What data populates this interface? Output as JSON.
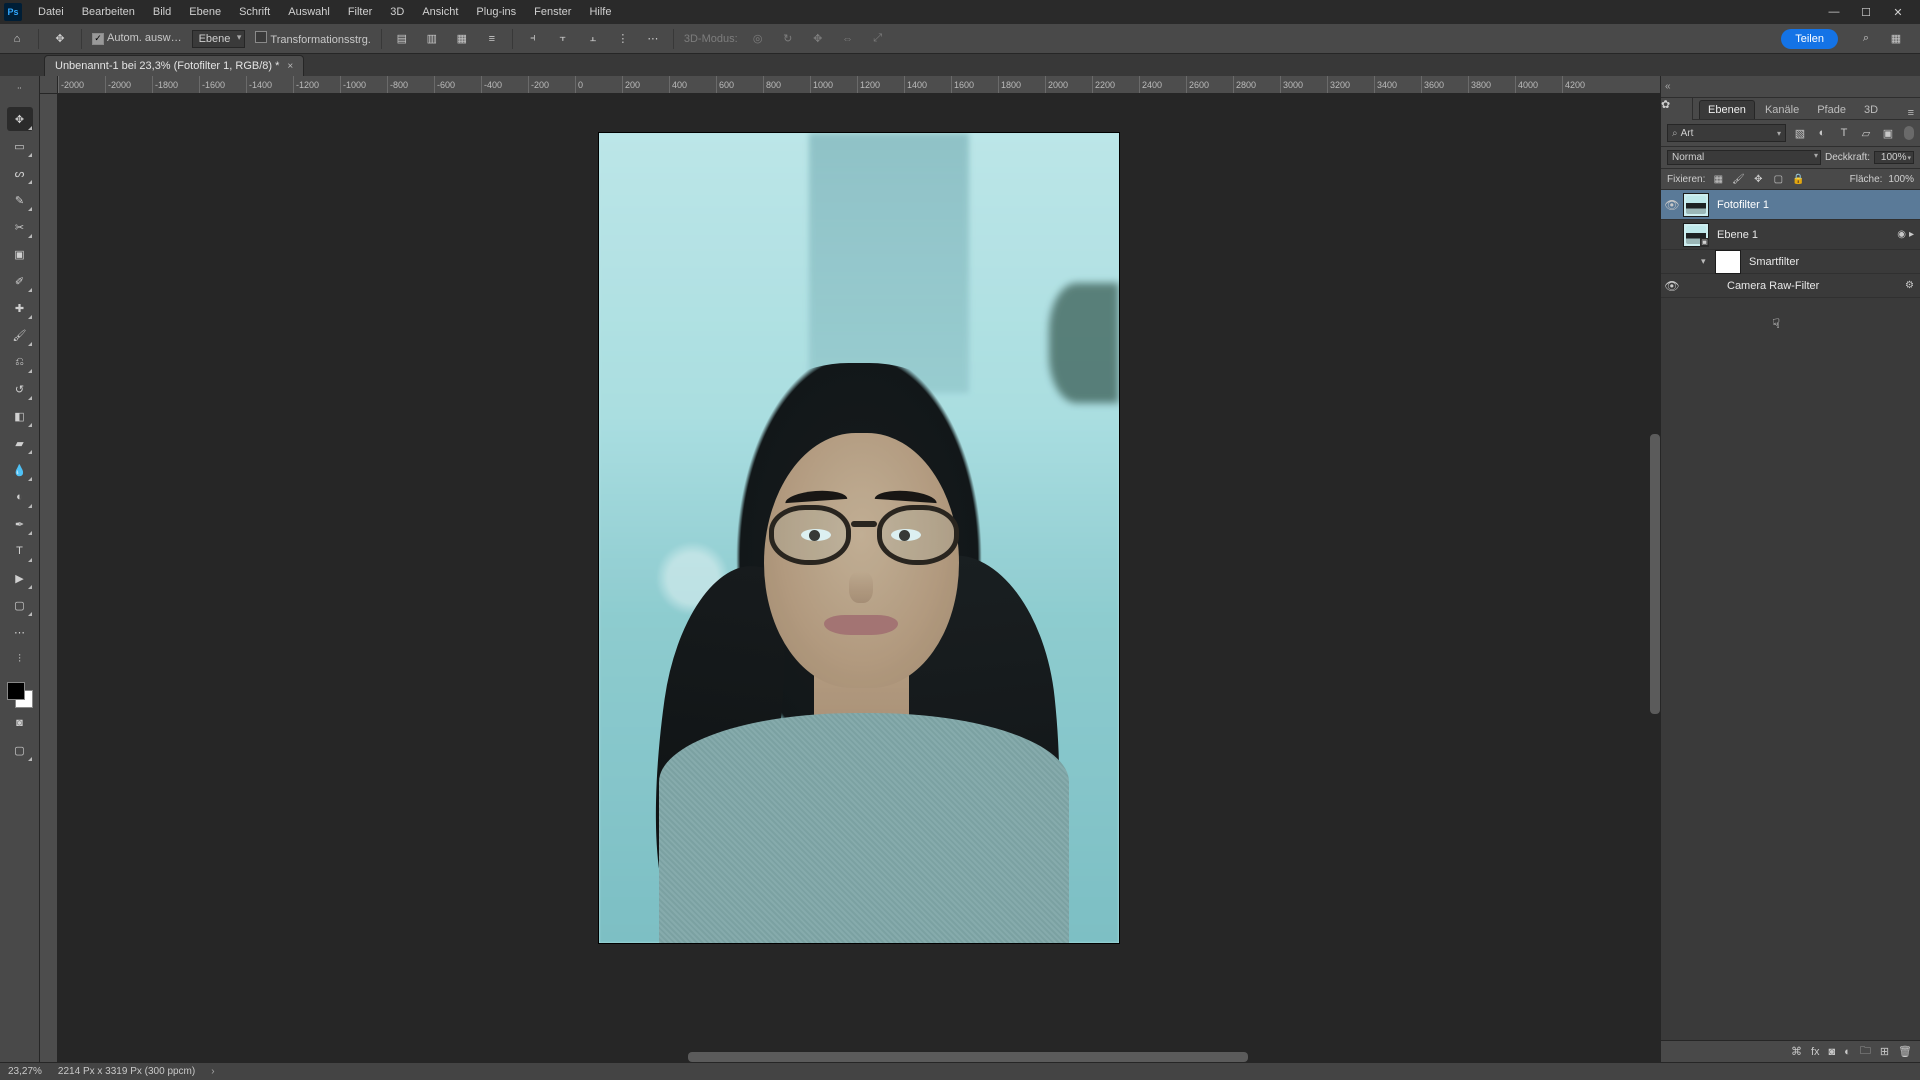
{
  "menu": {
    "items": [
      "Datei",
      "Bearbeiten",
      "Bild",
      "Ebene",
      "Schrift",
      "Auswahl",
      "Filter",
      "3D",
      "Ansicht",
      "Plug-ins",
      "Fenster",
      "Hilfe"
    ]
  },
  "options": {
    "auto_select_label": "Autom. ausw…",
    "auto_select_target": "Ebene",
    "transform_label": "Transformationsstrg.",
    "mode3d_label": "3D-Modus:",
    "share_label": "Teilen"
  },
  "doc": {
    "tab_title": "Unbenannt-1 bei 23,3% (Fotofilter 1, RGB/8) *"
  },
  "ruler_h": [
    "-2000",
    "-2000",
    "-1800",
    "-1600",
    "-1400",
    "-1200",
    "-1000",
    "-800",
    "-600",
    "-400",
    "-200",
    "0",
    "200",
    "400",
    "600",
    "800",
    "1000",
    "1200",
    "1400",
    "1600",
    "1800",
    "2000",
    "2200",
    "2400",
    "2600",
    "2800",
    "3000",
    "3200",
    "3400",
    "3600",
    "3800",
    "4000",
    "4200"
  ],
  "panels": {
    "tabs": [
      "Ebenen",
      "Kanäle",
      "Pfade",
      "3D"
    ],
    "search_label": "Art",
    "blend_mode": "Normal",
    "opacity_label": "Deckkraft:",
    "opacity_value": "100%",
    "fill_label": "Fläche:",
    "fill_value": "100%",
    "lock_label": "Fixieren:"
  },
  "layers": [
    {
      "name": "Fotofilter 1",
      "visible": true,
      "selected": true,
      "indent": 0,
      "thumb": "photo"
    },
    {
      "name": "Ebene 1",
      "visible": false,
      "selected": false,
      "indent": 0,
      "thumb": "smart",
      "tail": [
        "◉",
        "▸"
      ]
    },
    {
      "name": "Smartfilter",
      "visible": true,
      "selected": false,
      "indent": 1,
      "thumb": "mask",
      "expand": "▾"
    },
    {
      "name": "Camera Raw-Filter",
      "visible": true,
      "selected": false,
      "indent": 2,
      "thumb": "none",
      "tail": [
        "⚙"
      ]
    }
  ],
  "status": {
    "zoom": "23,27%",
    "dims": "2214 Px x 3319 Px (300 ppcm)"
  }
}
